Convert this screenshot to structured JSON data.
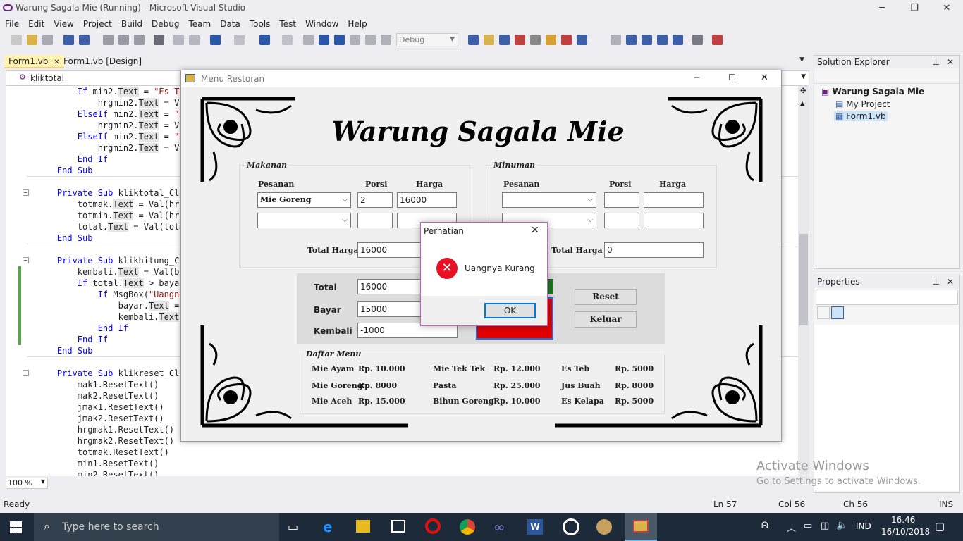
{
  "app": {
    "window_title": "Warung Sagala Mie (Running) - Microsoft Visual Studio",
    "minimize": "─",
    "restore": "❐",
    "close": "✕",
    "menu": [
      "File",
      "Edit",
      "View",
      "Project",
      "Build",
      "Debug",
      "Team",
      "Data",
      "Tools",
      "Test",
      "Window",
      "Help"
    ],
    "config": "Debug",
    "tabs": [
      {
        "label": "Form1.vb",
        "close": "✕"
      },
      {
        "label": "Form1.vb [Design]"
      }
    ],
    "nav_dropdown": "kliktotal",
    "zoom": "100 %"
  },
  "code_lines": [
    {
      "t": "        If min2.Text = \"Es Teh\""
    },
    {
      "t": "            hrgmin2.Text = Val("
    },
    {
      "t": "        ElseIf min2.Text = \"Jus"
    },
    {
      "t": "            hrgmin2.Text = Val("
    },
    {
      "t": "        ElseIf min2.Text = \"Es"
    },
    {
      "t": "            hrgmin2.Text = Val("
    },
    {
      "t": "        End If"
    },
    {
      "t": "    End Sub"
    },
    {
      "t": ""
    },
    {
      "t": "    Private Sub kliktotal_Click"
    },
    {
      "t": "        totmak.Text = Val(hrgma"
    },
    {
      "t": "        totmin.Text = Val(hrgmi"
    },
    {
      "t": "        total.Text = Val(totmak"
    },
    {
      "t": "    End Sub"
    },
    {
      "t": ""
    },
    {
      "t": "    Private Sub klikhitung_Clic"
    },
    {
      "t": "        kembali.Text = Val(baya"
    },
    {
      "t": "        If total.Text > bayar.T"
    },
    {
      "t": "            If MsgBox(\"Uangnya"
    },
    {
      "t": "                bayar.Text = \"\""
    },
    {
      "t": "                kembali.Text ="
    },
    {
      "t": "            End If"
    },
    {
      "t": "        End If"
    },
    {
      "t": "    End Sub"
    },
    {
      "t": ""
    },
    {
      "t": "    Private Sub klikreset_Click"
    },
    {
      "t": "        mak1.ResetText()"
    },
    {
      "t": "        mak2.ResetText()"
    },
    {
      "t": "        jmak1.ResetText()"
    },
    {
      "t": "        jmak2.ResetText()"
    },
    {
      "t": "        hrgmak1.ResetText()"
    },
    {
      "t": "        hrgmak2.ResetText()"
    },
    {
      "t": "        totmak.ResetText()"
    },
    {
      "t": "        min1.ResetText()"
    },
    {
      "t": "        min2.ResetText()"
    }
  ],
  "solution_explorer": {
    "title": "Solution Explorer",
    "project": "Warung Sagala Mie",
    "items": [
      "My Project",
      "Form1.vb"
    ]
  },
  "properties": {
    "title": "Properties"
  },
  "watermark": {
    "line1": "Activate Windows",
    "line2": "Go to Settings to activate Windows."
  },
  "status": {
    "left": "Ready",
    "ln": "Ln 57",
    "col": "Col 56",
    "ch": "Ch 56",
    "ins": "INS"
  },
  "taskbar": {
    "search_placeholder": "Type here to search",
    "lang": "IND",
    "time": "16.46",
    "date": "16/10/2018"
  },
  "form": {
    "title": "Menu Restoran",
    "heading": "Warung Sagala Mie",
    "makanan": {
      "group": "Makanan",
      "col_pesanan": "Pesanan",
      "col_porsi": "Porsi",
      "col_harga": "Harga",
      "row1": {
        "item": "Mie Goreng",
        "porsi": "2",
        "harga": "16000"
      },
      "row2": {
        "item": "",
        "porsi": "",
        "harga": ""
      },
      "total_label": "Total Harga",
      "total": "16000"
    },
    "minuman": {
      "group": "Minuman",
      "col_pesanan": "Pesanan",
      "col_porsi": "Porsi",
      "col_harga": "Harga",
      "row1": {
        "item": "",
        "porsi": "",
        "harga": ""
      },
      "row2": {
        "item": "",
        "porsi": "",
        "harga": ""
      },
      "total_label": "Total Harga",
      "total": "0"
    },
    "payment": {
      "total_label": "Total",
      "total": "16000",
      "bayar_label": "Bayar",
      "bayar": "15000",
      "kembali_label": "Kembali",
      "kembali": "-1000"
    },
    "buttons": {
      "reset": "Reset",
      "keluar": "Keluar"
    },
    "daftar": {
      "title": "Daftar Menu",
      "items": [
        {
          "name": "Mie Ayam",
          "price": "Rp. 10.000"
        },
        {
          "name": "Mie Goreng",
          "price": "Rp. 8000"
        },
        {
          "name": "Mie Aceh",
          "price": "Rp. 15.000"
        },
        {
          "name": "Mie Tek Tek",
          "price": "Rp. 12.000"
        },
        {
          "name": "Pasta",
          "price": "Rp. 25.000"
        },
        {
          "name": "Bihun Goreng",
          "price": "Rp. 10.000"
        },
        {
          "name": "Es Teh",
          "price": "Rp. 5000"
        },
        {
          "name": "Jus Buah",
          "price": "Rp. 8000"
        },
        {
          "name": "Es Kelapa",
          "price": "Rp. 5000"
        }
      ]
    }
  },
  "dialog": {
    "title": "Perhatian",
    "message": "Uangnya Kurang",
    "ok": "OK",
    "close": "✕"
  },
  "colors": {
    "vs_purple": "#68217a",
    "form_red": "#e00000",
    "form_green": "#1a7a1a",
    "error_red": "#e81123"
  }
}
